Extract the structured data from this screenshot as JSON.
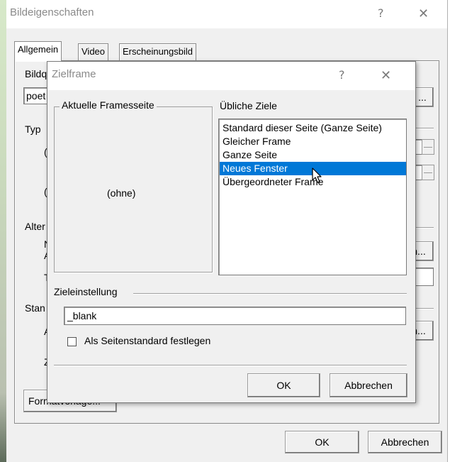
{
  "back_dialog": {
    "title": "Bildeigenschaften",
    "help_glyph": "?",
    "close_glyph": "✕",
    "tabs": [
      {
        "label": "Allgemein"
      },
      {
        "label": "Video"
      },
      {
        "label": "Erscheinungsbild"
      }
    ],
    "fragments": {
      "bildquelle": "Bildq",
      "path": "poet",
      "typ": "Typ",
      "alt": "Alter",
      "n": "N",
      "a1": "A",
      "t": "T",
      "stan": "Stan",
      "a2": "A",
      "z": "Z",
      "browse1": "...",
      "browse2": "n...",
      "browse3": "n..."
    },
    "format_button": "Formatvorlage...",
    "ok_label": "OK",
    "cancel_label": "Abbrechen"
  },
  "zielframe": {
    "title": "Zielframe",
    "help_glyph": "?",
    "close_glyph": "✕",
    "current_group_label": "Aktuelle Framesseite",
    "current_frame_value": "(ohne)",
    "common_targets_label": "Übliche Ziele",
    "targets": [
      {
        "label": "Standard dieser Seite (Ganze Seite)"
      },
      {
        "label": "Gleicher Frame"
      },
      {
        "label": "Ganze Seite"
      },
      {
        "label": "Neues Fenster"
      },
      {
        "label": "Übergeordneter Frame"
      }
    ],
    "selected_target_index": 3,
    "setting_label": "Zieleinstellung",
    "target_value": "_blank",
    "checkbox_label": "Als Seitenstandard festlegen",
    "checkbox_checked": false,
    "ok_label": "OK",
    "cancel_label": "Abbrechen"
  }
}
